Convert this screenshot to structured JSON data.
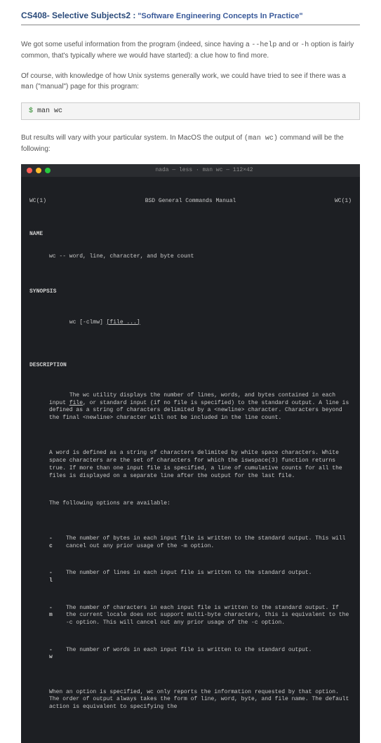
{
  "header": {
    "course": "CS408- Selective Subjects2 :",
    "subtitle": "\"Software Engineering Concepts In Practice\""
  },
  "para1_a": "We got some useful information from the program (indeed, since having a ",
  "para1_b": "--help",
  "para1_c": " and or ",
  "para1_d": "-h",
  "para1_e": " option is fairly common, that's typically where we would have started): a clue how to find more.",
  "para2_a": "Of course, with knowledge of how Unix systems generally work, we could have tried to see if there was a ",
  "para2_b": "man",
  "para2_c": " (\"manual\") page for this program:",
  "codeblock": {
    "prompt": "$ ",
    "cmd": "man wc"
  },
  "para3_a": "But results will vary with your particular system. In MacOS the output of ",
  "para3_b": "(man wc)",
  "para3_c": " command will be the following:",
  "terminal": {
    "title": "nada — less · man wc — 112×42",
    "header_left": "WC(1)",
    "header_center": "BSD General Commands Manual",
    "header_right": "WC(1)",
    "sec_name": "NAME",
    "name_line": "wc -- word, line, character, and byte count",
    "sec_synopsis": "SYNOPSIS",
    "syn_line_a": "wc [-clmw] ",
    "syn_line_b": "[file ...]",
    "sec_desc": "DESCRIPTION",
    "desc_p1_a": "The wc utility displays the number of lines, words, and bytes contained in each input ",
    "desc_p1_b": "file",
    "desc_p1_c": ", or standard input (if no file is specified) to the standard output. A line is defined as a string of characters delimited by a <newline> character. Characters beyond the final <newline> character will not be included in the line count.",
    "desc_p2": "A word is defined as a string of characters delimited by white space characters. White space characters are the set of characters for which the iswspace(3) function returns true. If more than one input file is specified, a line of cumulative counts for all the files is displayed on a separate line after the output for the last file.",
    "desc_p3": "The following options are available:",
    "opts": [
      {
        "flag": "-c",
        "desc": "The number of bytes in each input file is written to the standard output. This will cancel out any prior usage of the -m option."
      },
      {
        "flag": "-l",
        "desc": "The number of lines in each input file is written to the standard output."
      },
      {
        "flag": "-m",
        "desc": "The number of characters in each input file is written to the standard output. If the current locale does not support multi-byte characters, this is equivalent to the -c option. This will cancel out any prior usage of the -c option."
      },
      {
        "flag": "-w",
        "desc": "The number of words in each input file is written to the standard output."
      }
    ],
    "desc_p4": "When an option is specified, wc only reports the information requested by that option. The order of output always takes the form of line, word, byte, and file name. The default action is equivalent to specifying the"
  }
}
